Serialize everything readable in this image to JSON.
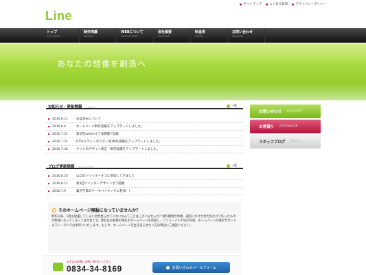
{
  "header": {
    "logo": "Line",
    "links": [
      "サイトマップ",
      "よくある質問",
      "プライバシーポリシー"
    ]
  },
  "nav": [
    {
      "jp": "トップ",
      "en": "TOP PAGE"
    },
    {
      "jp": "制作実績",
      "en": "WORKS"
    },
    {
      "jp": "WEBについて",
      "en": "ABOUT WEB"
    },
    {
      "jp": "会社概要",
      "en": "OUTLINE"
    },
    {
      "jp": "料金表",
      "en": "PRICE"
    },
    {
      "jp": "お問い合わせ",
      "en": "INQUIRY"
    }
  ],
  "hero": {
    "text": "あなたの想像を創造へ"
  },
  "news": {
    "title": "お知らせ・更新情報",
    "sub": "TOPICS",
    "more": "一覧",
    "items": [
      {
        "date": "2010.8.11",
        "text": "お盆休みについて"
      },
      {
        "date": "2010.8.6",
        "text": "ホームページ制作実績をアップデートしました。"
      },
      {
        "date": "2010.7.31",
        "text": "第3回twitterオフ会開催!!記録"
      },
      {
        "date": "2010.7.31",
        "text": "DTP(チラシ・ポスター等)制作実績をアップデートしました。"
      },
      {
        "date": "2010.7.30",
        "text": "サイトのデザイン修正・制作実績をアップデートしました。"
      }
    ]
  },
  "blog": {
    "title": "ブログ更新情報",
    "sub": "BLOGTOPICS",
    "more": "一覧",
    "items": [
      {
        "date": "2010.8.23",
        "text": "山口のツイッターオフに参加してきました"
      },
      {
        "date": "2010.8.11",
        "text": "第3回ツイッターデザインオフ開催"
      },
      {
        "date": "2010.7.9",
        "text": "菓子乃家のケーキバイキングに参加！！"
      }
    ]
  },
  "sidebar": [
    {
      "jp": "お問い合わせ",
      "en": "INQUIRY"
    },
    {
      "jp": "お見積り",
      "en": "ESTIMATE"
    },
    {
      "jp": "スタッフブログ",
      "en": "BLOG"
    }
  ],
  "promo": {
    "title": "そのホームページ無駄になっていませんか？",
    "body": "制作以来、1度も放置してしまい全然見られていないなんてことはございませんか？制作費用や時間、運営にかけた労力をかけて作ったものが無駄になってしまっては大変です。弊社はお客様の現在のホームページを見直し、リニューアルやSEO対策、ホームページの運営サポートまでトータルでお手伝いいたします。もし今、ホームページを生き返らせたい方は弊社にご相談ください。"
  },
  "contact": {
    "note": "まずはお気軽にお問い合わせください",
    "tel": "0834-34-8169",
    "button": "お問い合わせメールフォーム"
  },
  "colors": {
    "accent": "#8ac82a",
    "red": "#c4183a",
    "blue": "#1e5fa6"
  }
}
